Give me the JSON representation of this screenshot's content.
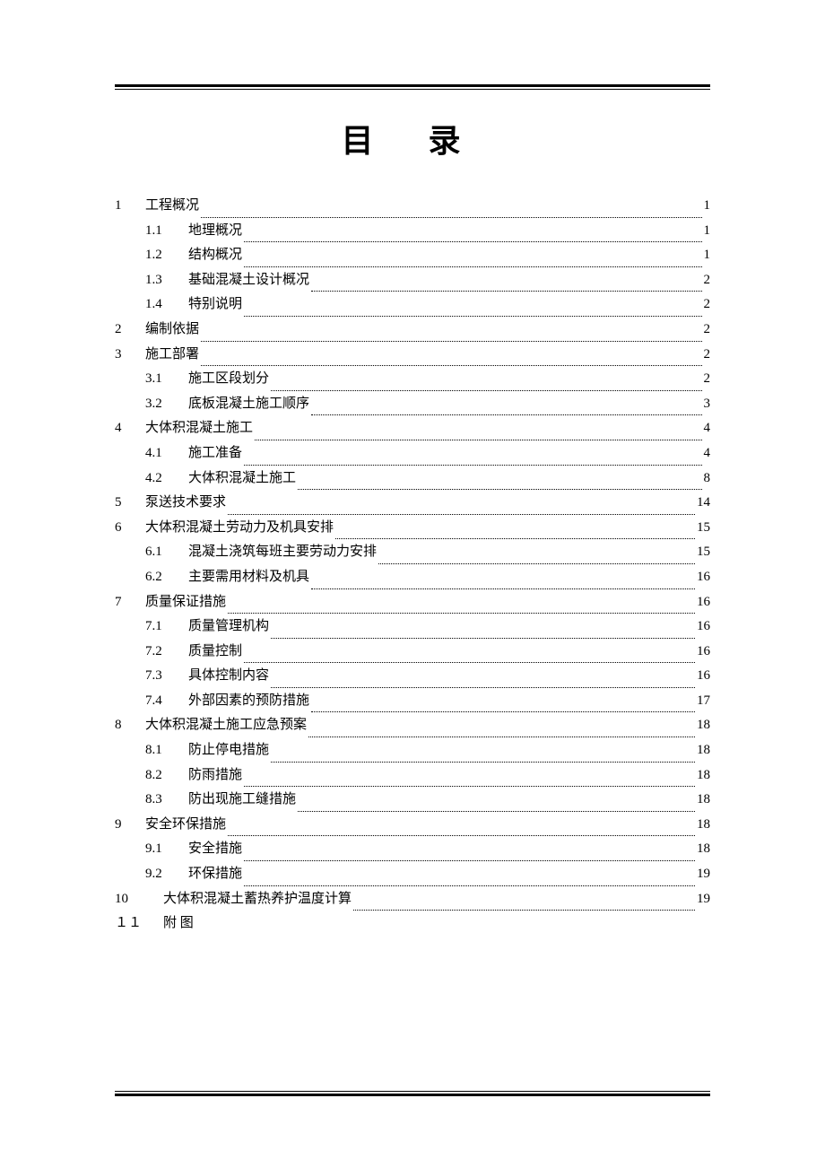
{
  "title": "目 录",
  "toc": [
    {
      "level": 1,
      "num": "1",
      "title": "工程概况",
      "page": "1"
    },
    {
      "level": 2,
      "num": "1.1",
      "title": "地理概况",
      "page": "1"
    },
    {
      "level": 2,
      "num": "1.2",
      "title": "结构概况",
      "page": "1"
    },
    {
      "level": 2,
      "num": "1.3",
      "title": "基础混凝土设计概况",
      "page": "2"
    },
    {
      "level": 2,
      "num": "1.4",
      "title": "特别说明",
      "page": "2"
    },
    {
      "level": 1,
      "num": "2",
      "title": "编制依据",
      "page": "2"
    },
    {
      "level": 1,
      "num": "3",
      "title": "施工部署",
      "page": "2"
    },
    {
      "level": 2,
      "num": "3.1",
      "title": "施工区段划分",
      "page": "2"
    },
    {
      "level": 2,
      "num": "3.2",
      "title": "底板混凝土施工顺序",
      "page": "3"
    },
    {
      "level": 1,
      "num": "4",
      "title": "大体积混凝土施工",
      "page": "4"
    },
    {
      "level": 2,
      "num": "4.1",
      "title": "施工准备",
      "page": "4"
    },
    {
      "level": 2,
      "num": "4.2",
      "title": "大体积混凝土施工",
      "page": "8"
    },
    {
      "level": 1,
      "num": "5",
      "title": "泵送技术要求",
      "page": "14"
    },
    {
      "level": 1,
      "num": "6",
      "title": "大体积混凝土劳动力及机具安排",
      "page": "15"
    },
    {
      "level": 2,
      "num": "6.1",
      "title": "混凝土浇筑每班主要劳动力安排",
      "page": "15"
    },
    {
      "level": 2,
      "num": "6.2",
      "title": "主要需用材料及机具",
      "page": "16"
    },
    {
      "level": 1,
      "num": "7",
      "title": "质量保证措施",
      "page": "16"
    },
    {
      "level": 2,
      "num": "7.1",
      "title": "质量管理机构",
      "page": "16"
    },
    {
      "level": 2,
      "num": "7.2",
      "title": "质量控制",
      "page": "16"
    },
    {
      "level": 2,
      "num": "7.3",
      "title": "具体控制内容",
      "page": "16"
    },
    {
      "level": 2,
      "num": "7.4",
      "title": "外部因素的预防措施",
      "page": "17"
    },
    {
      "level": 1,
      "num": "8",
      "title": "大体积混凝土施工应急预案",
      "page": "18"
    },
    {
      "level": 2,
      "num": "8.1",
      "title": "防止停电措施",
      "page": "18"
    },
    {
      "level": 2,
      "num": "8.2",
      "title": "防雨措施",
      "page": "18"
    },
    {
      "level": 2,
      "num": "8.3",
      "title": "防出现施工缝措施",
      "page": "18"
    },
    {
      "level": 1,
      "num": "9",
      "title": "安全环保措施",
      "page": "18"
    },
    {
      "level": 2,
      "num": "9.1",
      "title": "安全措施",
      "page": "18"
    },
    {
      "level": 2,
      "num": "9.2",
      "title": "环保措施",
      "page": "19"
    },
    {
      "level": 1,
      "num": "10",
      "title": "大体积混凝土蓄热养护温度计算",
      "page": "19",
      "indent_title": true
    },
    {
      "level": 1,
      "num": "１１",
      "title": "附 图",
      "page": "",
      "no_leader": true,
      "indent_title": true
    }
  ]
}
